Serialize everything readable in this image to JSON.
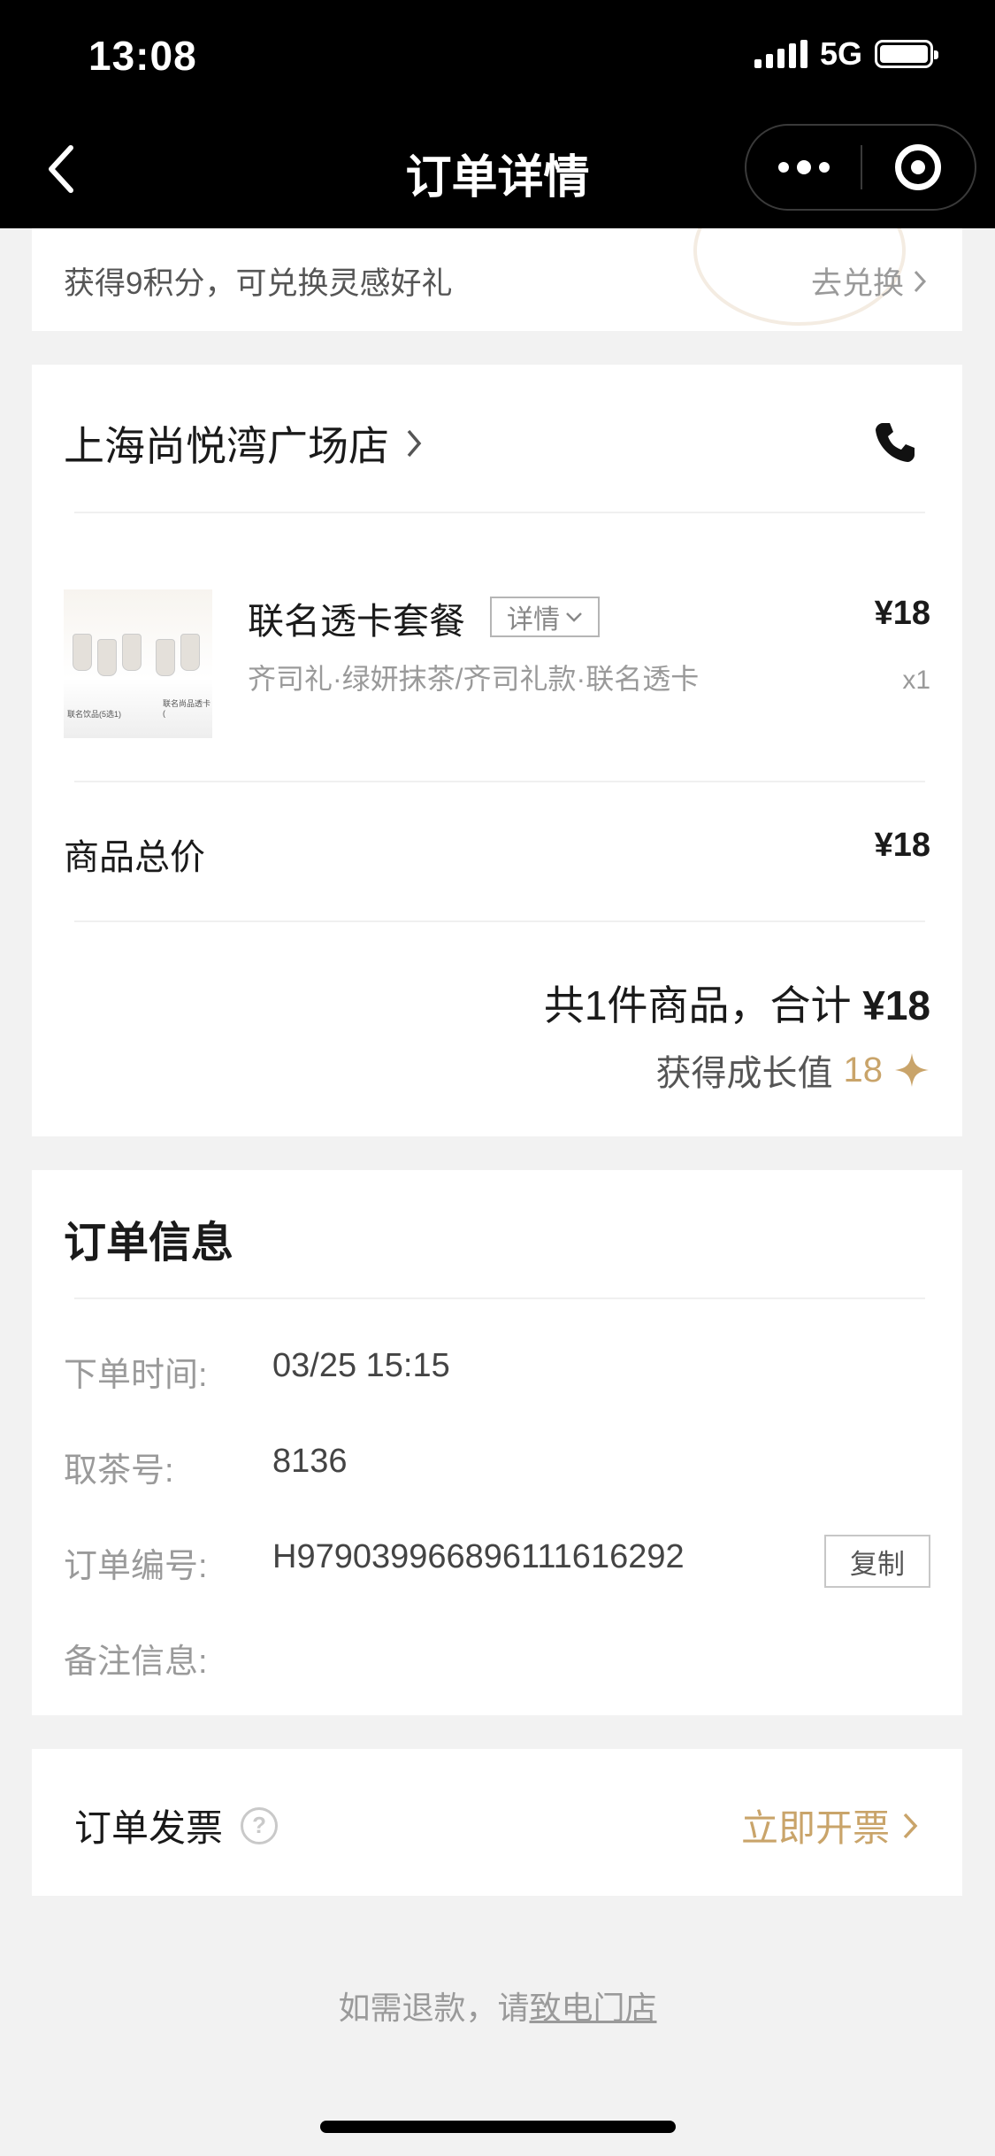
{
  "status_bar": {
    "time": "13:08",
    "network": "5G"
  },
  "nav": {
    "title": "订单详情",
    "more_icon": "more-dots-icon",
    "close_icon": "target-circle-icon"
  },
  "points_banner": {
    "text": "获得9积分，可兑换灵感好礼",
    "link_label": "去兑换"
  },
  "store": {
    "name": "上海尚悦湾广场店",
    "phone_icon": "phone-icon"
  },
  "item": {
    "thumbnail_captions": [
      "联名饮品(5选1)",
      "联名尚品透卡("
    ],
    "name": "联名透卡套餐",
    "detail_label": "详情",
    "spec": "齐司礼·绿妍抹茶/齐司礼款·联名透卡",
    "price": "¥18",
    "quantity": "x1"
  },
  "summary": {
    "subtotal_label": "商品总价",
    "subtotal_value": "¥18",
    "total_prefix": "共1件商品，合计",
    "total_value": "¥18",
    "growth_label": "获得成长值",
    "growth_value": "18",
    "accent_color": "#c9a46a"
  },
  "order_info": {
    "title": "订单信息",
    "rows": [
      {
        "key": "下单时间:",
        "value": "03/25 15:15"
      },
      {
        "key": "取茶号:",
        "value": "8136"
      },
      {
        "key": "订单编号:",
        "value": "H97903996689611161629​2"
      },
      {
        "key": "备注信息:",
        "value": ""
      }
    ],
    "copy_label": "复制"
  },
  "invoice": {
    "label": "订单发票",
    "link_label": "立即开票"
  },
  "refund_note": {
    "prefix": "如需退款，请",
    "link": "致电门店"
  }
}
